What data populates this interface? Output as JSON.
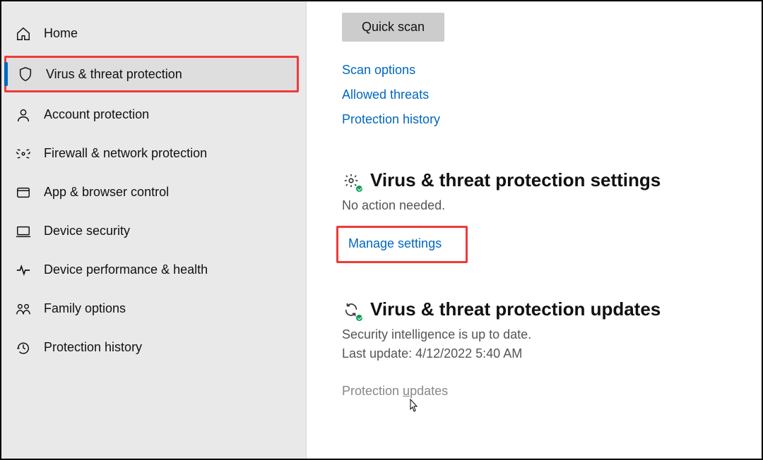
{
  "sidebar": {
    "items": [
      {
        "label": "Home"
      },
      {
        "label": "Virus & threat protection"
      },
      {
        "label": "Account protection"
      },
      {
        "label": "Firewall & network protection"
      },
      {
        "label": "App & browser control"
      },
      {
        "label": "Device security"
      },
      {
        "label": "Device performance & health"
      },
      {
        "label": "Family options"
      },
      {
        "label": "Protection history"
      }
    ]
  },
  "main": {
    "quick_scan": "Quick scan",
    "links": {
      "scan_options": "Scan options",
      "allowed_threats": "Allowed threats",
      "protection_history": "Protection history"
    },
    "settings_section": {
      "title": "Virus & threat protection settings",
      "status": "No action needed.",
      "manage": "Manage settings"
    },
    "updates_section": {
      "title": "Virus & threat protection updates",
      "status": "Security intelligence is up to date.",
      "last_update": "Last update: 4/12/2022 5:40 AM",
      "protection_updates_prefix": "Protection ",
      "protection_updates_underlined": "u",
      "protection_updates_suffix": "pdates"
    }
  }
}
